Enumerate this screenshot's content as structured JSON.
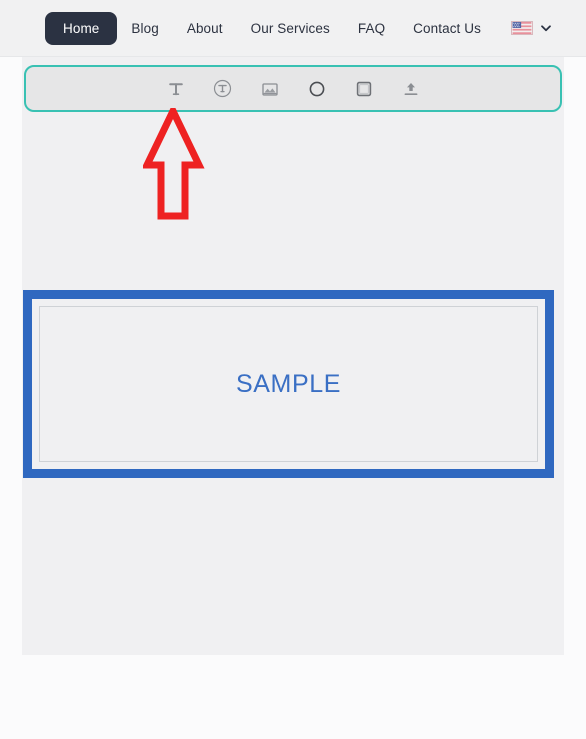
{
  "navbar": {
    "items": [
      {
        "label": "Home",
        "active": true
      },
      {
        "label": "Blog",
        "active": false
      },
      {
        "label": "About",
        "active": false
      },
      {
        "label": "Our Services",
        "active": false
      },
      {
        "label": "FAQ",
        "active": false
      },
      {
        "label": "Contact Us",
        "active": false
      }
    ],
    "language_switcher": {
      "flag": "us-flag-icon",
      "chevron": "chevron-down-icon"
    },
    "active_color": "#2b3242",
    "text_color": "#2c3240",
    "background": "#f1f1f2"
  },
  "toolbar": {
    "highlight_color": "#39c1b3",
    "background": "#e6e6e7",
    "tools": [
      {
        "name": "text-tool",
        "icon": "text-t-icon",
        "title": "Text"
      },
      {
        "name": "typography-tool",
        "icon": "circled-t-icon",
        "title": "Typography"
      },
      {
        "name": "image-tool",
        "icon": "image-icon",
        "title": "Image"
      },
      {
        "name": "circle-shape-tool",
        "icon": "circle-icon",
        "title": "Circle"
      },
      {
        "name": "square-shape-tool",
        "icon": "square-icon",
        "title": "Square"
      },
      {
        "name": "upload-tool",
        "icon": "upload-icon",
        "title": "Upload"
      }
    ]
  },
  "annotation": {
    "arrow": "red-up-arrow",
    "color": "#ee2222",
    "points_to": "text-tool"
  },
  "canvas": {
    "background": "#f0f0f2",
    "sample_block": {
      "text": "SAMPLE",
      "border_color": "#2f68c0",
      "text_color": "#3a6fc4",
      "inner_border_color": "#cfd2d6"
    }
  }
}
